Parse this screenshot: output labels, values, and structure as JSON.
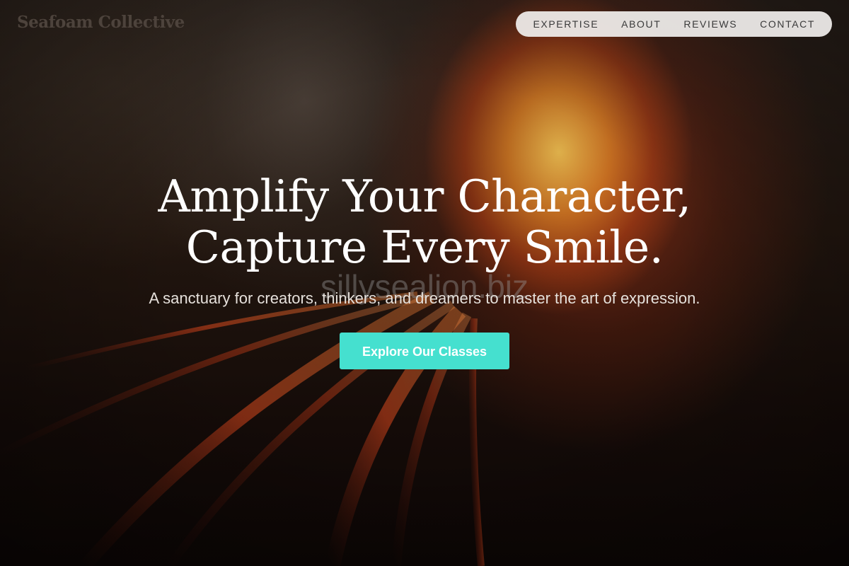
{
  "brand": {
    "name": "Seafoam Collective"
  },
  "nav": {
    "items": [
      {
        "label": "EXPERTISE"
      },
      {
        "label": "ABOUT"
      },
      {
        "label": "REVIEWS"
      },
      {
        "label": "CONTACT"
      }
    ]
  },
  "hero": {
    "headline_line1": "Amplify Your Character,",
    "headline_line2": "Capture Every Smile.",
    "subtitle": "A sanctuary for creators, thinkers, and dreamers to master the art of expression.",
    "cta_label": "Explore Our Classes",
    "watermark": "sillysealion.biz"
  },
  "colors": {
    "accent": "#45e0cf",
    "nav_background": "#f0eeec",
    "headline": "#ffffff",
    "logo": "#4d433c"
  },
  "background": {
    "description_icon": "forge-glow-image"
  }
}
